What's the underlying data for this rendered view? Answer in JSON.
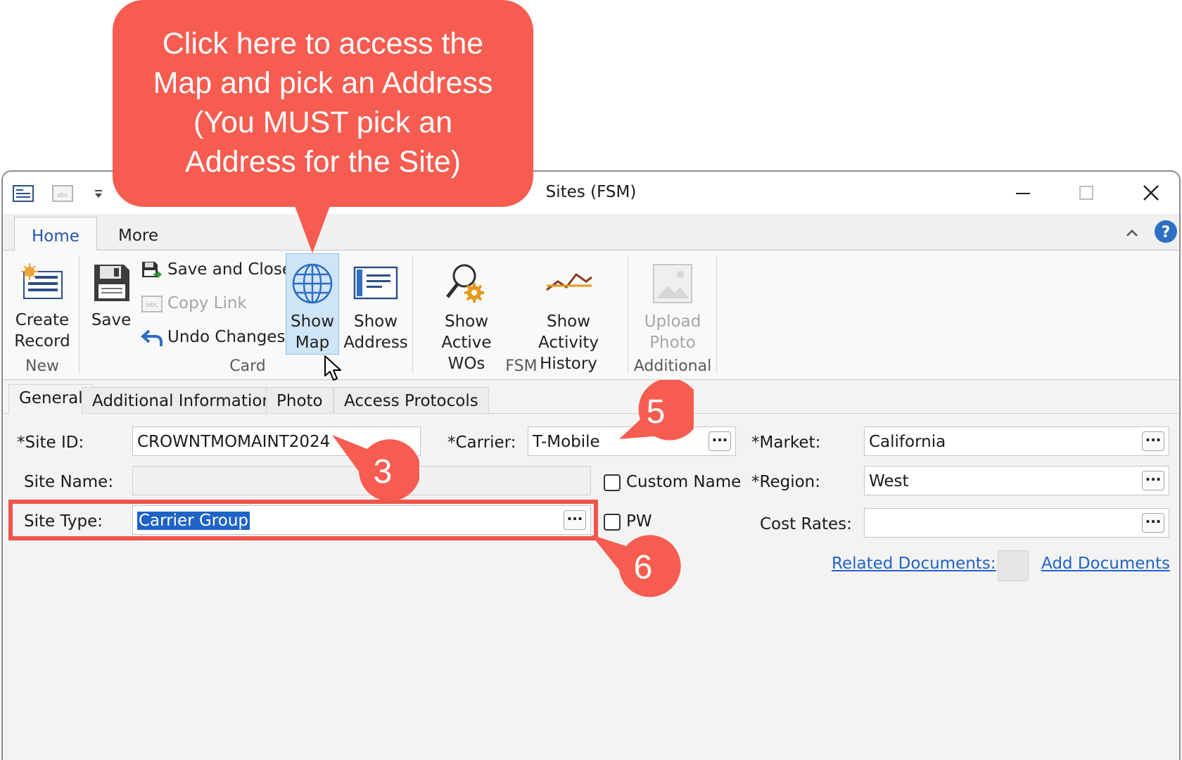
{
  "callout": {
    "line1": "Click here to access the",
    "line2": "Map and pick an Address",
    "line3": "(You MUST pick an",
    "line4": "Address for the Site)"
  },
  "window": {
    "title": "Sites (FSM)"
  },
  "ribbon_tabs": {
    "home": "Home",
    "more": "More"
  },
  "ribbon": {
    "create_record": [
      "Create",
      "Record"
    ],
    "save": "Save",
    "save_and_close": "Save and Close",
    "copy_link": "Copy Link",
    "undo_changes": "Undo Changes",
    "show_map": [
      "Show",
      "Map"
    ],
    "show_address": [
      "Show",
      "Address"
    ],
    "show_active_wos": [
      "Show",
      "Active WOs"
    ],
    "show_activity_history": [
      "Show Activity",
      "History"
    ],
    "upload_photo": [
      "Upload",
      "Photo"
    ],
    "groups": {
      "new": "New",
      "card": "Card",
      "fsm": "FSM",
      "additional": "Additional"
    }
  },
  "form_tabs": [
    "General",
    "Additional Information",
    "Photo",
    "Access Protocols"
  ],
  "form": {
    "site_id": {
      "label": "*Site ID:",
      "value": "CROWNTMOMAINT2024"
    },
    "site_name": {
      "label": "Site Name:",
      "value": ""
    },
    "site_type": {
      "label": "Site Type:",
      "value": "Carrier Group"
    },
    "carrier": {
      "label": "*Carrier:",
      "value": "T-Mobile"
    },
    "custom_name": {
      "label": "Custom Name",
      "checked": false
    },
    "pw": {
      "label": "PW",
      "checked": false
    },
    "market": {
      "label": "*Market:",
      "value": "California"
    },
    "region": {
      "label": "*Region:",
      "value": "West"
    },
    "cost_rates": {
      "label": "Cost Rates:",
      "value": ""
    },
    "related_documents": "Related Documents:",
    "add_documents": "Add Documents",
    "ellipsis": "···"
  },
  "badges": {
    "three": "3",
    "five": "5",
    "six": "6"
  },
  "colors": {
    "callout": "#f75c50",
    "accent": "#1f63c6",
    "highlight_box": "#f0554b"
  }
}
